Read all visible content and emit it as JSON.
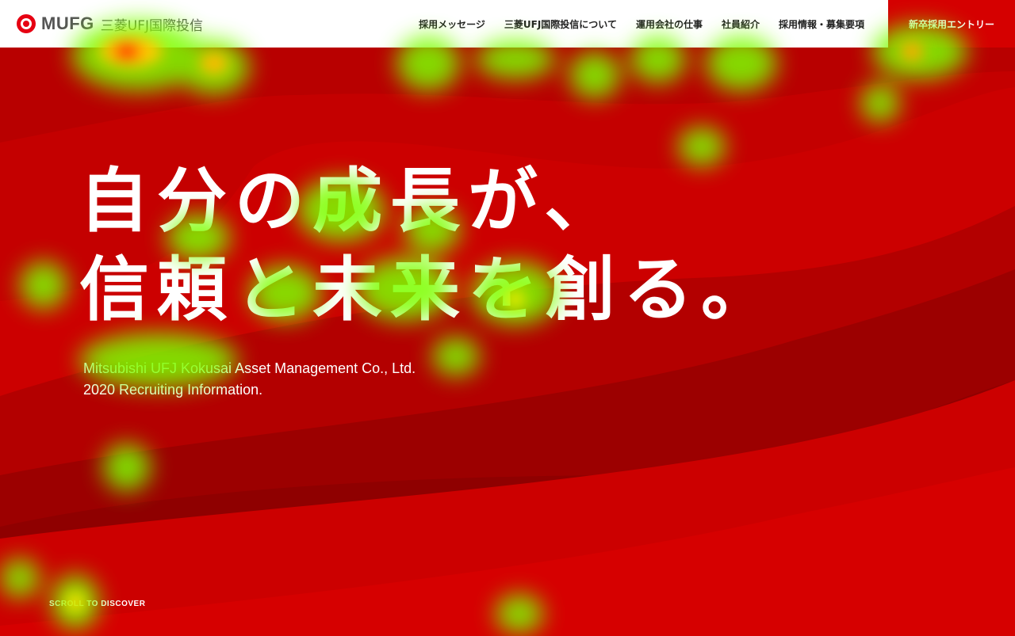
{
  "header": {
    "logo_text": "MUFG",
    "logo_sub": "三菱UFJ国際投信",
    "nav": [
      "採用メッセージ",
      "三菱UFJ国際投信について",
      "運用会社の仕事",
      "社員紹介",
      "採用情報・募集要項"
    ],
    "entry_label": "新卒採用エントリー"
  },
  "hero": {
    "line1": "自分の成長が、",
    "line2": "信頼と未来を創る。",
    "sub1": "Mitsubishi UFJ Kokusai Asset Management Co., Ltd.",
    "sub2": "2020 Recruiting Information."
  },
  "scroll_label": "SCROLL TO DISCOVER",
  "colors": {
    "brand_red": "#d50000",
    "bg_dark": "#990000",
    "bg_light": "#cc0000"
  }
}
